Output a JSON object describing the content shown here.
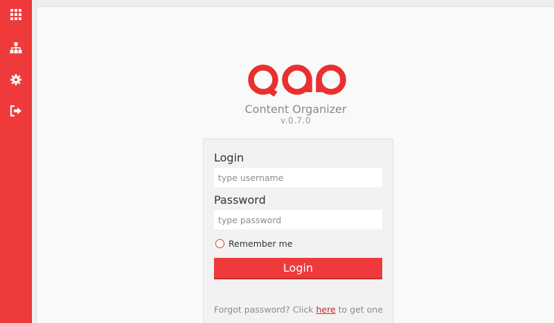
{
  "sidebar": {
    "items": [
      {
        "icon": "apps-grid-icon"
      },
      {
        "icon": "sitemap-icon"
      },
      {
        "icon": "gear-icon"
      },
      {
        "icon": "sign-out-icon"
      }
    ],
    "accent_color": "#ef3a3b"
  },
  "brand": {
    "logo_icon": "qap-logo",
    "logo_text": "QAP",
    "app_name": "Content Organizer",
    "version": "v.0.7.0"
  },
  "login_form": {
    "login_label": "Login",
    "username_placeholder": "type username",
    "username_value": "",
    "password_label": "Password",
    "password_placeholder": "type password",
    "password_value": "",
    "remember_label": "Remember me",
    "remember_checked": false,
    "submit_label": "Login",
    "forgot_prefix": "Forgot password? Click ",
    "forgot_link": "here",
    "forgot_suffix": " to get one"
  }
}
